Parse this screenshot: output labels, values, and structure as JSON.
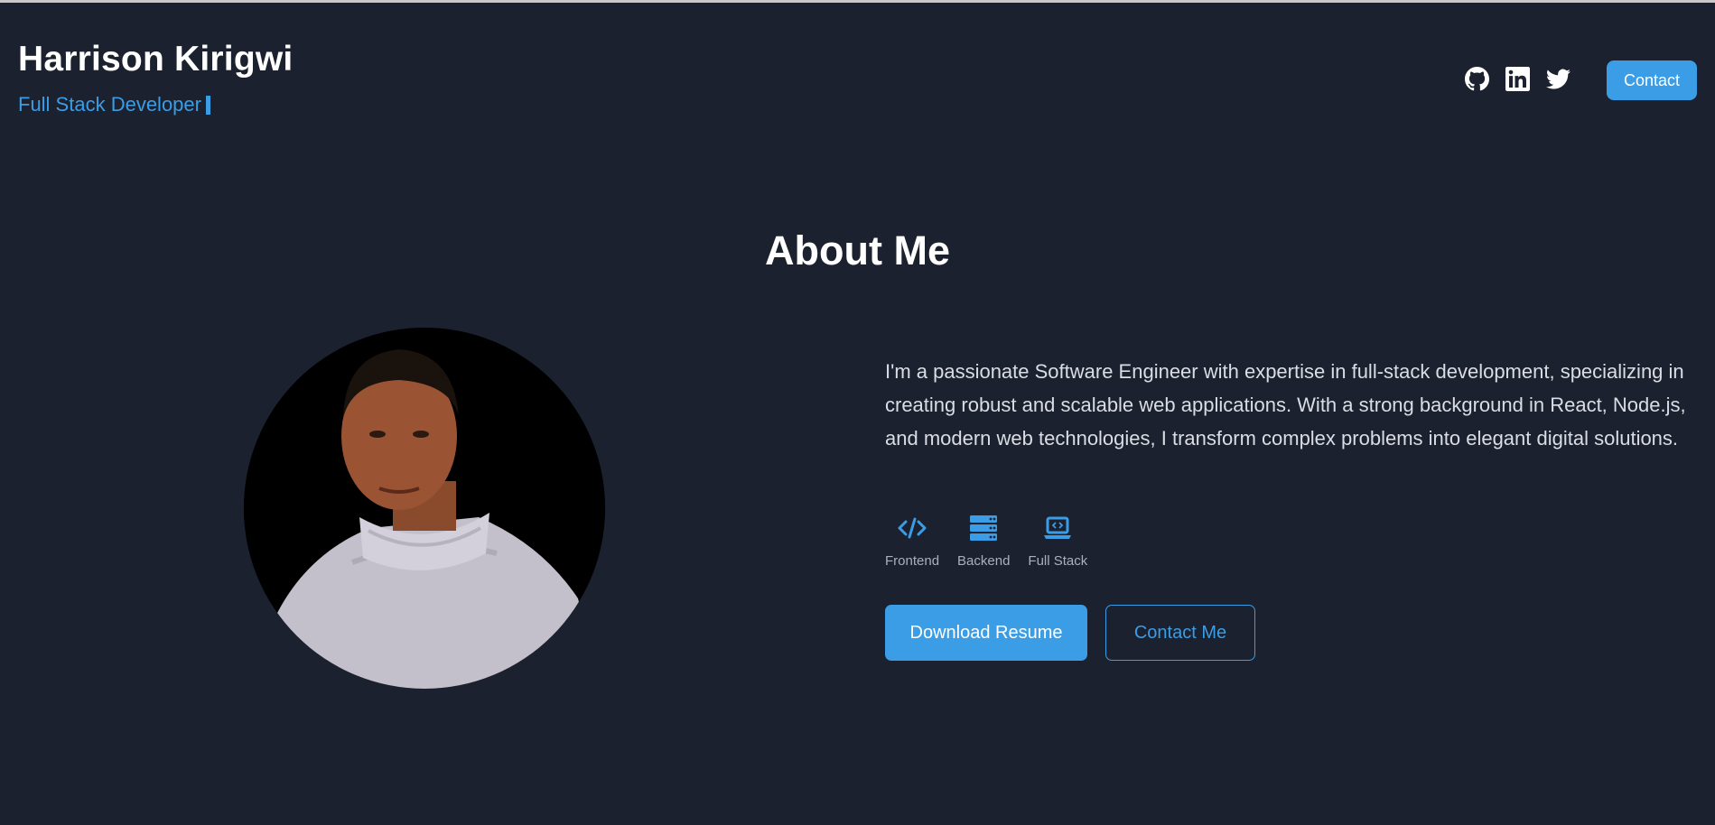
{
  "header": {
    "name": "Harrison Kirigwi",
    "role": "Full Stack Developer",
    "socials": [
      {
        "icon": "github-icon"
      },
      {
        "icon": "linkedin-icon"
      },
      {
        "icon": "twitter-icon"
      }
    ],
    "contact_label": "Contact"
  },
  "about": {
    "title": "About Me",
    "bio": "I'm a passionate Software Engineer with expertise in full-stack development, specializing in creating robust and scalable web applications. With a strong background in React, Node.js, and modern web technologies, I transform complex problems into elegant digital solutions.",
    "skills": [
      {
        "label": "Frontend",
        "icon": "code-icon"
      },
      {
        "label": "Backend",
        "icon": "server-icon"
      },
      {
        "label": "Full Stack",
        "icon": "laptop-code-icon"
      }
    ],
    "download_label": "Download Resume",
    "contact_me_label": "Contact Me"
  },
  "colors": {
    "background": "#1b212e",
    "accent": "#3a9de6",
    "text": "#ffffff",
    "muted": "#a9b0bc"
  }
}
